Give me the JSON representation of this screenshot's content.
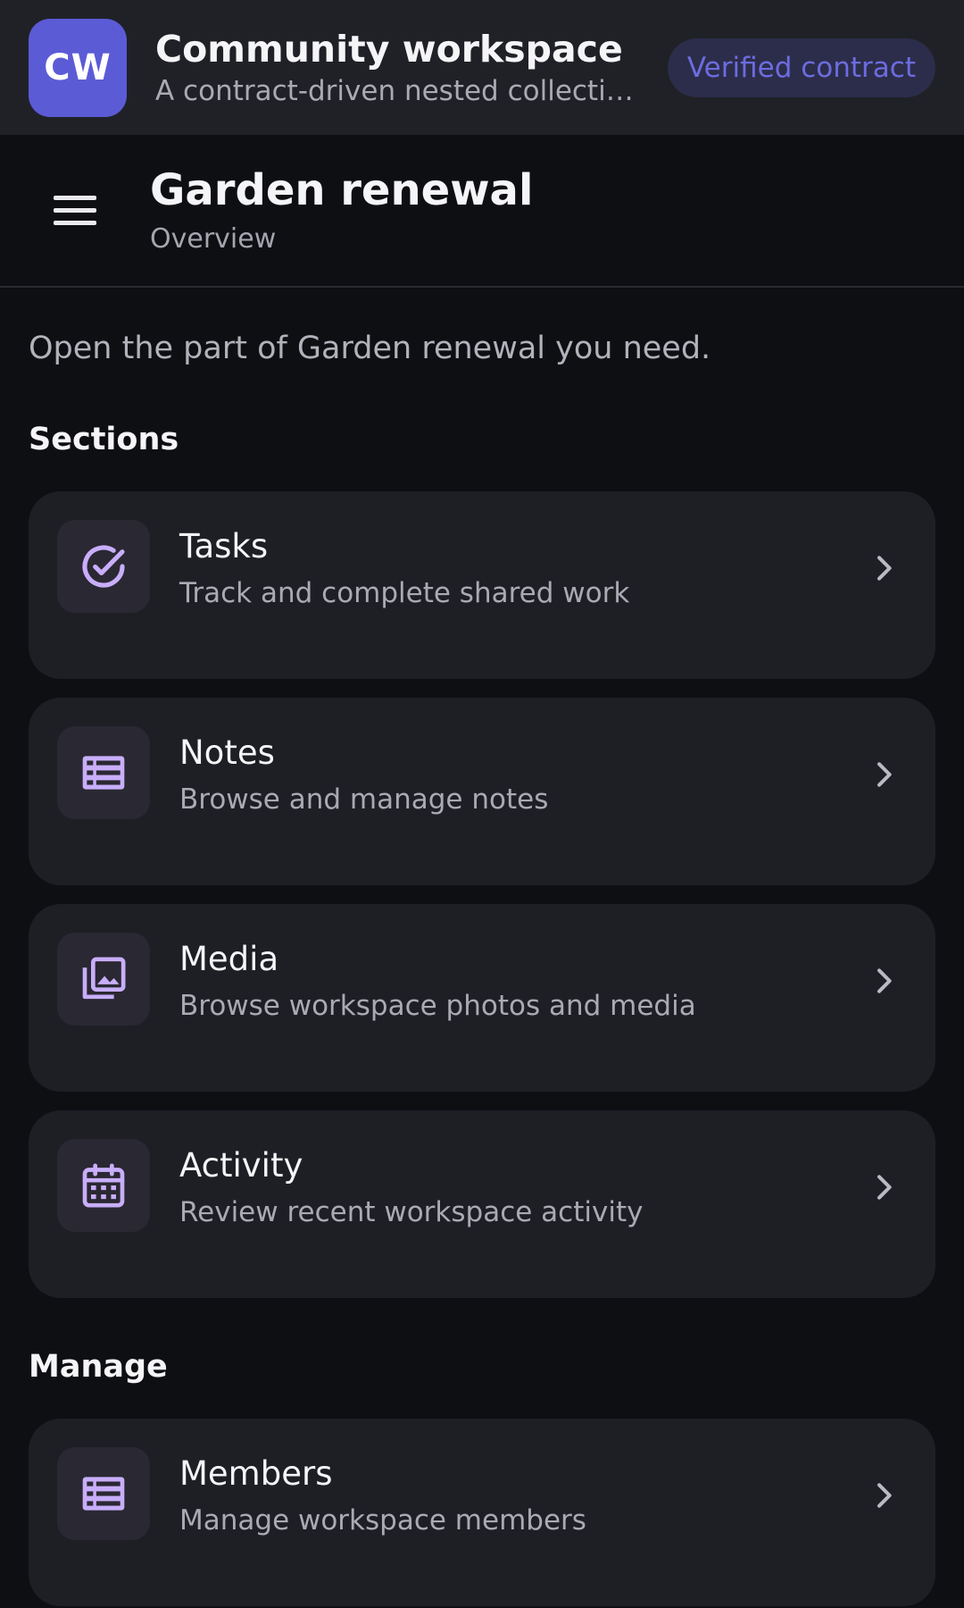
{
  "appbar": {
    "avatar_text": "CW",
    "title": "Community workspace",
    "subtitle": "A contract-driven nested collection ...",
    "badge": "Verified contract"
  },
  "page": {
    "title": "Garden renewal",
    "subtitle": "Overview",
    "intro": "Open the part of Garden renewal you need."
  },
  "sections": {
    "label": "Sections",
    "items": [
      {
        "title": "Tasks",
        "description": "Track and complete shared work",
        "icon": "check-circle-icon"
      },
      {
        "title": "Notes",
        "description": "Browse and manage notes",
        "icon": "list-icon"
      },
      {
        "title": "Media",
        "description": "Browse workspace photos and media",
        "icon": "photo-library-icon"
      },
      {
        "title": "Activity",
        "description": "Review recent workspace activity",
        "icon": "calendar-icon"
      }
    ]
  },
  "manage": {
    "label": "Manage",
    "items": [
      {
        "title": "Members",
        "description": "Manage workspace members",
        "icon": "list-icon"
      }
    ]
  },
  "colors": {
    "accent": "#5b5bd6",
    "icon_tint": "#c8aefb",
    "card_bg": "#1e1f25",
    "page_bg": "#0e0f13"
  }
}
